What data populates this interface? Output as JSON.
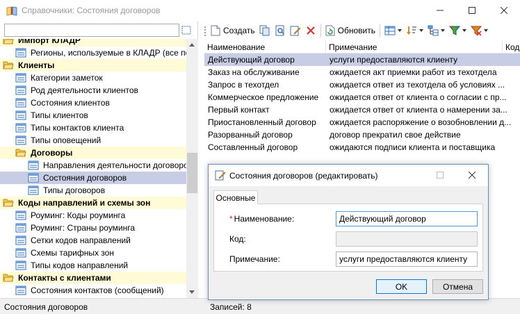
{
  "window": {
    "title": "Справочники: Состояния договоров"
  },
  "left": {
    "tree": [
      {
        "label": "Импорт КЛАДР",
        "type": "group",
        "level": 0
      },
      {
        "label": "Регионы, используемые в КЛАДР (все по",
        "type": "item",
        "level": 1
      },
      {
        "label": "Клиенты",
        "type": "group",
        "level": 0
      },
      {
        "label": "Категории заметок",
        "type": "item",
        "level": 1
      },
      {
        "label": "Род деятельности клиентов",
        "type": "item",
        "level": 1
      },
      {
        "label": "Состояния клиентов",
        "type": "item",
        "level": 1
      },
      {
        "label": "Типы клиентов",
        "type": "item",
        "level": 1
      },
      {
        "label": "Типы контактов клиента",
        "type": "item",
        "level": 1
      },
      {
        "label": "Типы оповещений",
        "type": "item",
        "level": 1
      },
      {
        "label": "Договоры",
        "type": "group",
        "level": 1
      },
      {
        "label": "Направления деятельности договоров",
        "type": "item",
        "level": 2
      },
      {
        "label": "Состояния договоров",
        "type": "item",
        "level": 2,
        "selected": true
      },
      {
        "label": "Типы договоров",
        "type": "item",
        "level": 2
      },
      {
        "label": "Коды направлений и схемы зон",
        "type": "group",
        "level": 0
      },
      {
        "label": "Роуминг: Коды роуминга",
        "type": "item",
        "level": 1
      },
      {
        "label": "Роуминг: Страны роуминга",
        "type": "item",
        "level": 1
      },
      {
        "label": "Сетки кодов направлений",
        "type": "item",
        "level": 1
      },
      {
        "label": "Схемы тарифных зон",
        "type": "item",
        "level": 1
      },
      {
        "label": "Типы кодов направлений",
        "type": "item",
        "level": 1
      },
      {
        "label": "Контакты с клиентами",
        "type": "group",
        "level": 0
      },
      {
        "label": "Состояния контактов (сообщений)",
        "type": "item",
        "level": 1
      }
    ]
  },
  "toolbar": {
    "create_label": "Создать",
    "refresh_label": "Обновить"
  },
  "grid": {
    "columns": [
      "Наименование",
      "Примечание",
      "Код"
    ],
    "rows": [
      {
        "name": "Действующий договор",
        "note": "услуги предоставляются клиенту",
        "selected": true
      },
      {
        "name": "Заказ на обслуживание",
        "note": "ожидается акт приемки работ из техотдела"
      },
      {
        "name": "Запрос в техотдел",
        "note": "ожидается ответ из техотдела об условиях ..."
      },
      {
        "name": "Коммерческое предложение",
        "note": "ожидается ответ от клиента о согласии с пр..."
      },
      {
        "name": "Первый контакт",
        "note": "ожидается ответ от клиента о намерении за..."
      },
      {
        "name": "Приостановленный договор",
        "note": "ожидается распоряжение о возобновлении д..."
      },
      {
        "name": "Разорванный договор",
        "note": "договор прекратил свое действие"
      },
      {
        "name": "Составленный договор",
        "note": "ожидаются подписи клиента и поставщика"
      }
    ]
  },
  "status": {
    "left": "Состояния договоров",
    "right": "Записей: 8"
  },
  "dialog": {
    "title": "Состояния договоров (редактировать)",
    "tab": "Основные",
    "required_mark": "*",
    "fields": {
      "name_label": "Наименование:",
      "name_value": "Действующий договор",
      "code_label": "Код:",
      "code_value": "",
      "note_label": "Примечание:",
      "note_value": "услуги предоставляются клиенту"
    },
    "ok_label": "OK",
    "cancel_label": "Отмена"
  },
  "colors": {
    "selection": "#c6cde4",
    "group_bg": "#fffbd6",
    "accent": "#0078d7"
  }
}
